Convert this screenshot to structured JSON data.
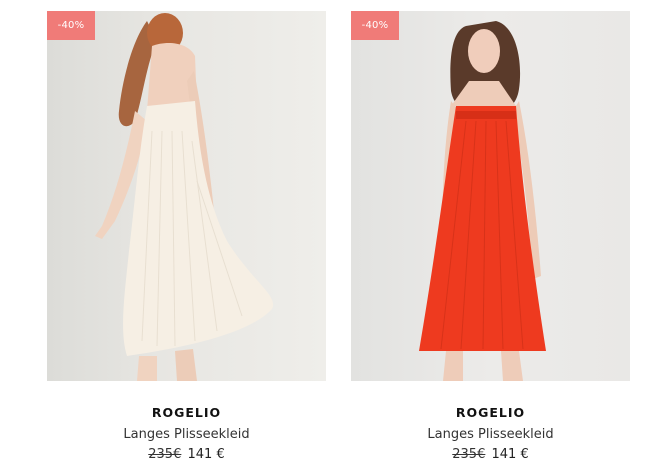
{
  "products": [
    {
      "badge": "-40%",
      "brand": "ROGELIO",
      "name": "Langes Plisseekleid",
      "old_price": "235€",
      "new_price": "141 €",
      "dress_color": "#f6efe4"
    },
    {
      "badge": "-40%",
      "brand": "ROGELIO",
      "name": "Langes Plisseekleid",
      "old_price": "235€",
      "new_price": "141 €",
      "dress_color": "#ee3a1f"
    }
  ],
  "colors": {
    "badge": "#f07b78"
  }
}
